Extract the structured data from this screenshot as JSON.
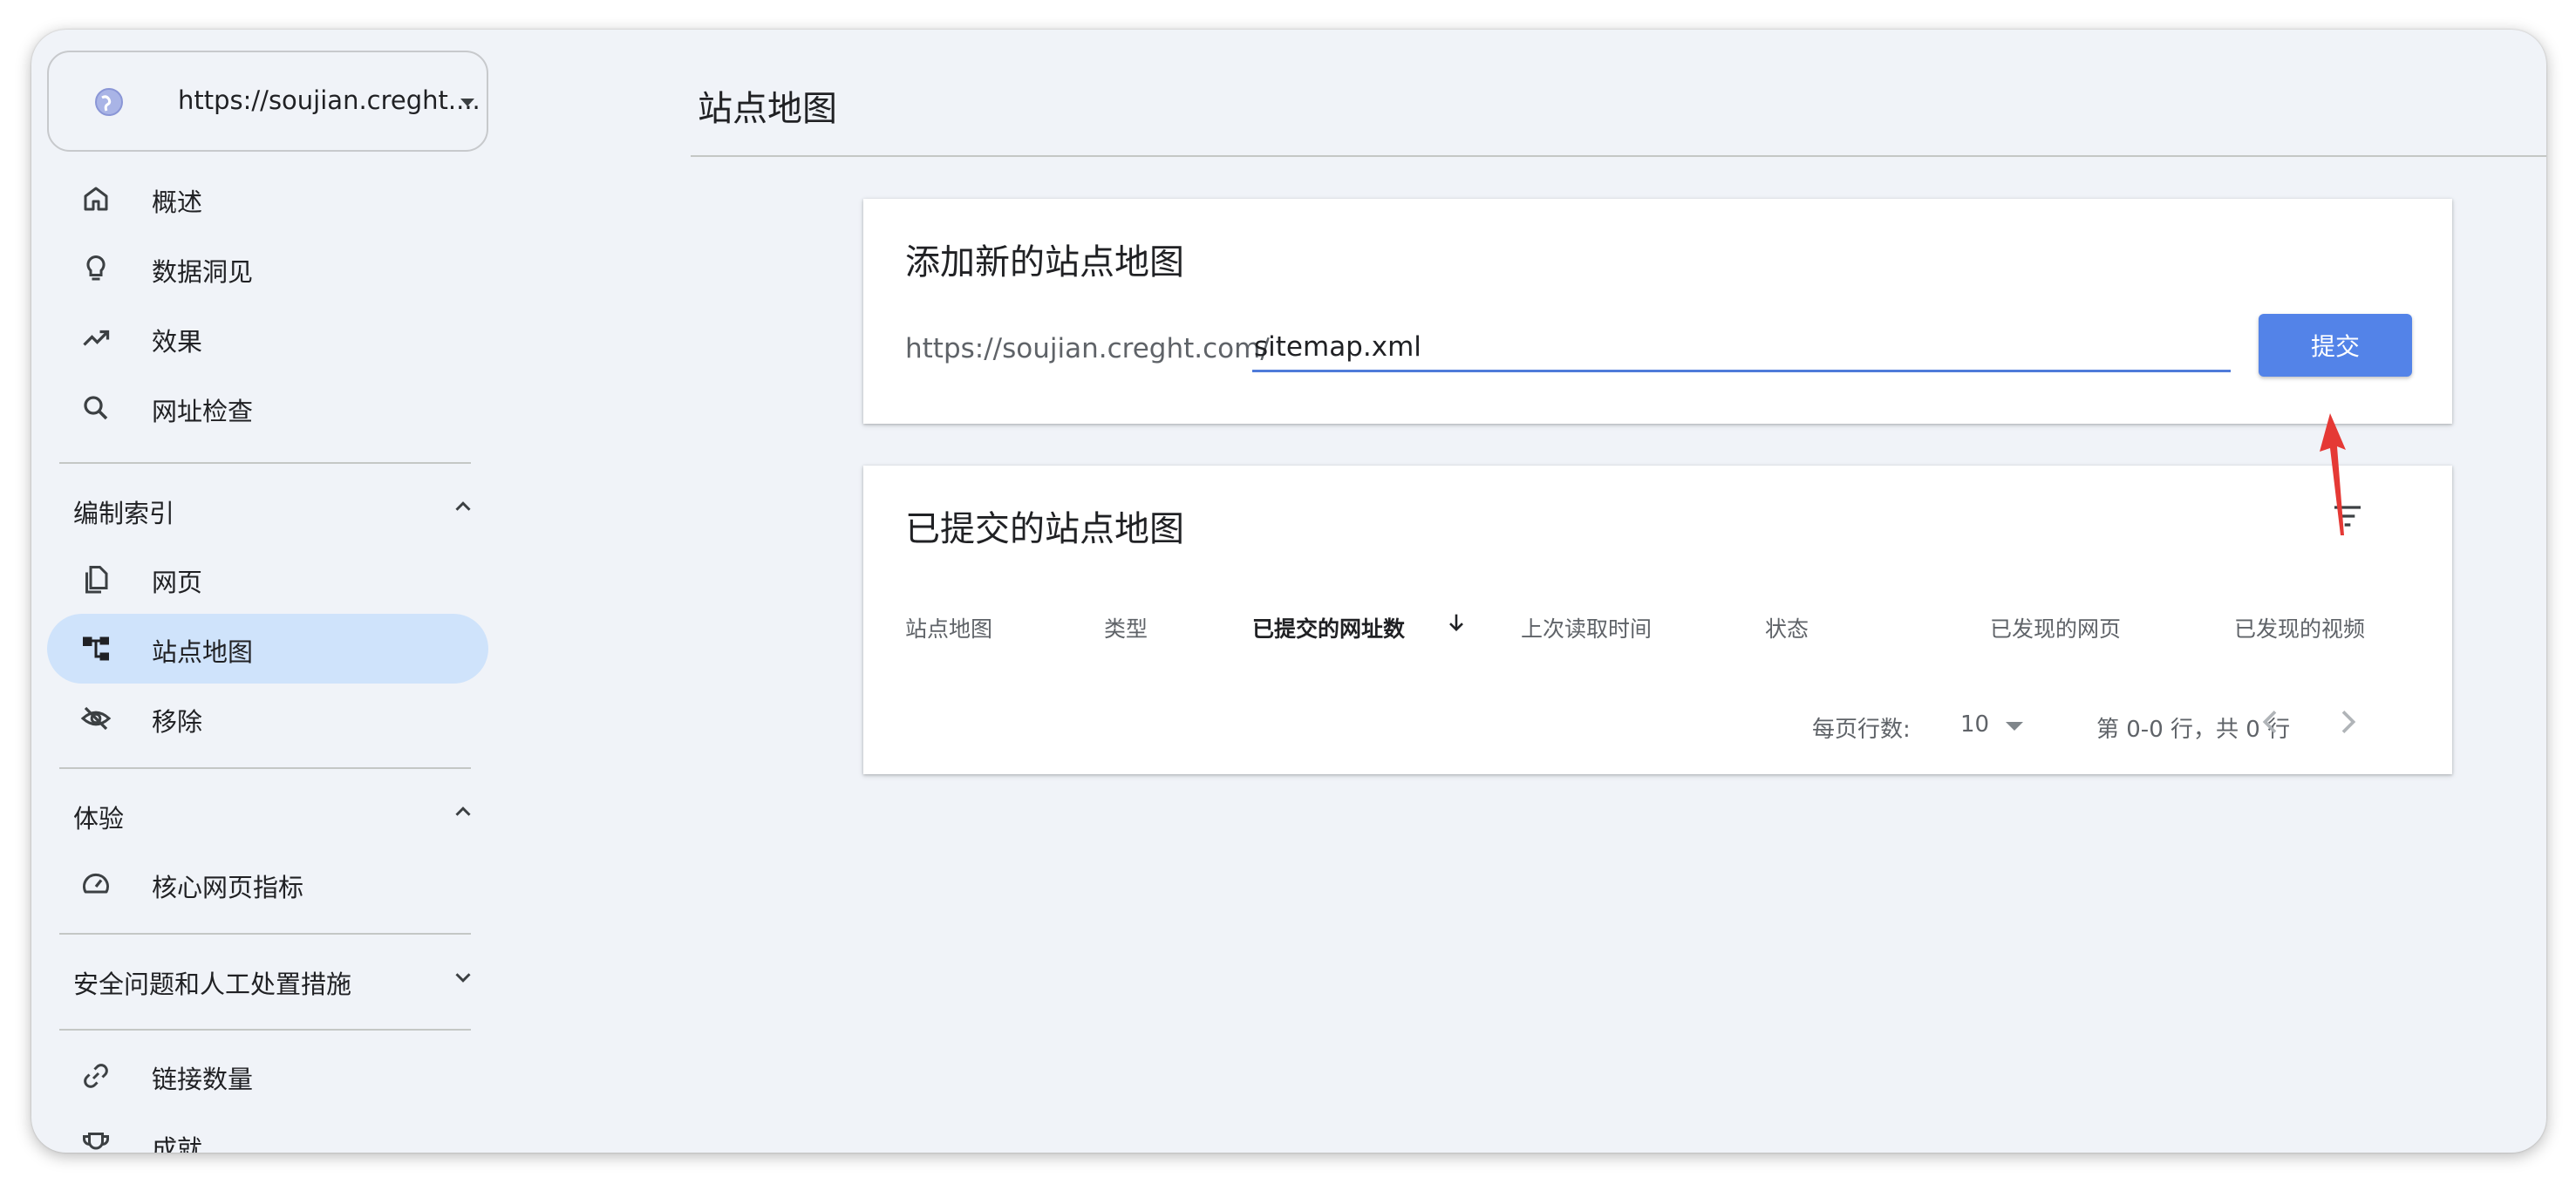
{
  "property": {
    "url": "https://soujian.creght...."
  },
  "nav": {
    "overview": "概述",
    "insights": "数据洞见",
    "performance": "效果",
    "url_inspection": "网址检查",
    "indexing_section": "编制索引",
    "pages": "网页",
    "sitemaps": "站点地图",
    "removals": "移除",
    "experience_section": "体验",
    "core_web_vitals": "核心网页指标",
    "security_section": "安全问题和人工处置措施",
    "links": "链接数量",
    "achievements": "成就"
  },
  "page": {
    "title": "站点地图"
  },
  "add_sitemap": {
    "title": "添加新的站点地图",
    "url_prefix": "https://soujian.creght.com/",
    "input_value": "sitemap.xml",
    "submit_label": "提交"
  },
  "submitted": {
    "title": "已提交的站点地图",
    "columns": [
      "站点地图",
      "类型",
      "已提交的网址数",
      "上次读取时间",
      "状态",
      "已发现的网页",
      "已发现的视频"
    ],
    "rows_per_page_label": "每页行数:",
    "rows_per_page_value": "10",
    "range_text": "第 0-0 行，共 0 行"
  },
  "colors": {
    "accent": "#5383e8",
    "active_nav": "#cfe3fb",
    "background": "#f0f3f8",
    "annotation": "#e53935"
  }
}
